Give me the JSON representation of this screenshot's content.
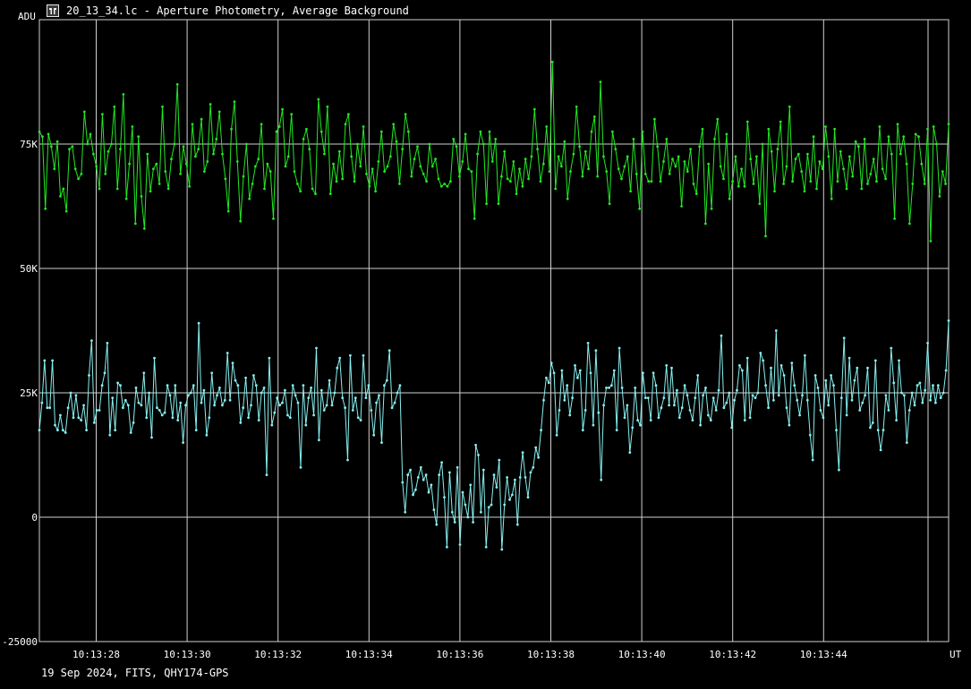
{
  "window": {
    "title": "20_13_34.lc - Aperture Photometry, Average Background",
    "icon": "app-logo-icon"
  },
  "footer": {
    "text": "19 Sep 2024, FITS, QHY174-GPS"
  },
  "chart_data": {
    "type": "line",
    "ylabel": "ADU",
    "xlabel": "UT",
    "ylim": [
      -25000,
      100000
    ],
    "xlim": [
      "10:13:26.75",
      "10:13:46.75"
    ],
    "yticks": [
      {
        "value": 75000,
        "label": "75K"
      },
      {
        "value": 50000,
        "label": "50K"
      },
      {
        "value": 25000,
        "label": "25K"
      },
      {
        "value": 0,
        "label": "0"
      },
      {
        "value": -25000,
        "label": "-25000"
      }
    ],
    "xticks": [
      {
        "value": "10:13:28",
        "label": "10:13:28"
      },
      {
        "value": "10:13:30",
        "label": "10:13:30"
      },
      {
        "value": "10:13:32",
        "label": "10:13:32"
      },
      {
        "value": "10:13:34",
        "label": "10:13:34"
      },
      {
        "value": "10:13:36",
        "label": "10:13:36"
      },
      {
        "value": "10:13:38",
        "label": "10:13:38"
      },
      {
        "value": "10:13:40",
        "label": "10:13:40"
      },
      {
        "value": "10:13:42",
        "label": "10:13:42"
      },
      {
        "value": "10:13:44",
        "label": "10:13:44"
      }
    ],
    "grid": true,
    "background": "#000000",
    "grid_color": "#d0d0d0",
    "series": [
      {
        "color": "#22e822",
        "start": "10:13:26.75",
        "interval_s": 0.04,
        "values": [
          77500,
          76500,
          62000,
          77000,
          74500,
          70000,
          75500,
          64500,
          66000,
          61500,
          74000,
          74500,
          70000,
          68000,
          69000,
          81500,
          75000,
          77000,
          73000,
          70500,
          66000,
          81000,
          69000,
          73500,
          75000,
          82500,
          66000,
          74000,
          85000,
          64000,
          71000,
          78500,
          59000,
          76500,
          64500,
          58000,
          73000,
          65500,
          70000,
          71000,
          67000,
          82500,
          69500,
          66000,
          72000,
          75000,
          87000,
          69000,
          74500,
          71000,
          66500,
          79000,
          72500,
          74000,
          80000,
          69500,
          71500,
          83000,
          73000,
          76000,
          81500,
          73000,
          68000,
          61500,
          78000,
          83500,
          71500,
          59500,
          68500,
          75000,
          64000,
          67000,
          70500,
          72000,
          79000,
          66000,
          71000,
          69500,
          60000,
          77500,
          78500,
          82000,
          70500,
          72500,
          81000,
          69500,
          67000,
          65500,
          76000,
          78000,
          74000,
          66000,
          65000,
          84000,
          77500,
          73000,
          82500,
          65000,
          71000,
          67500,
          73500,
          68000,
          79000,
          81000,
          72500,
          67500,
          75000,
          70500,
          78500,
          69000,
          66500,
          70000,
          65500,
          71500,
          77500,
          69500,
          70500,
          72500,
          79000,
          75500,
          67000,
          74000,
          81000,
          77500,
          68500,
          72000,
          74500,
          70500,
          69000,
          67500,
          75000,
          70500,
          72000,
          68000,
          66500,
          67000,
          66500,
          67500,
          76000,
          74500,
          68500,
          71500,
          77000,
          70000,
          69500,
          60000,
          73000,
          77500,
          75000,
          63000,
          77500,
          71500,
          76000,
          63000,
          68500,
          73500,
          68000,
          67500,
          71500,
          65000,
          70000,
          66500,
          72000,
          68000,
          72500,
          82000,
          74000,
          67500,
          71000,
          78500,
          69500,
          91500,
          66000,
          72500,
          70500,
          75500,
          64000,
          69500,
          73000,
          82500,
          74500,
          68500,
          73500,
          70000,
          77500,
          80500,
          68500,
          87500,
          72500,
          69500,
          63000,
          77500,
          74000,
          70000,
          68000,
          70500,
          72500,
          65500,
          76000,
          69000,
          62000,
          77500,
          69000,
          67500,
          67500,
          80000,
          74500,
          67500,
          71500,
          76000,
          69000,
          72000,
          70500,
          72500,
          62500,
          71500,
          69500,
          74000,
          67000,
          65000,
          74500,
          78000,
          59000,
          71000,
          62000,
          76000,
          80000,
          70500,
          68000,
          77000,
          64000,
          67500,
          72500,
          66500,
          70000,
          66500,
          79500,
          72000,
          67000,
          72500,
          63000,
          75000,
          56500,
          78000,
          73500,
          65500,
          74000,
          79500,
          67000,
          70500,
          82500,
          67500,
          72000,
          73000,
          69500,
          65500,
          73000,
          67500,
          76500,
          66000,
          71500,
          70000,
          78500,
          72500,
          64000,
          78000,
          67500,
          73500,
          70000,
          66000,
          72500,
          68500,
          75500,
          74500,
          66000,
          76000,
          67000,
          69000,
          72000,
          67500,
          78500,
          70000,
          68000,
          76500,
          73000,
          60000,
          79000,
          73000,
          76500,
          71000,
          59000,
          67000,
          77000,
          76500,
          71000,
          67000,
          78000,
          55500,
          78500,
          75000,
          64500,
          69500,
          67000,
          79000
        ]
      },
      {
        "color": "#88f0f0",
        "start": "10:13:26.75",
        "interval_s": 0.04,
        "values": [
          17500,
          23000,
          31500,
          22000,
          22000,
          31500,
          18500,
          17500,
          20500,
          17500,
          17000,
          22000,
          25000,
          20000,
          24500,
          20000,
          19500,
          22500,
          17500,
          28500,
          35500,
          19000,
          21500,
          21500,
          26500,
          29000,
          35000,
          16500,
          24000,
          17500,
          27000,
          26500,
          22000,
          23500,
          22500,
          17000,
          19000,
          26000,
          23000,
          22500,
          29000,
          20000,
          25000,
          16000,
          32000,
          22000,
          21500,
          20500,
          21000,
          26500,
          24500,
          20000,
          26500,
          19500,
          23000,
          15000,
          22500,
          24500,
          25000,
          26500,
          17500,
          39000,
          23000,
          25500,
          16500,
          20000,
          29000,
          22500,
          24500,
          26000,
          22500,
          23500,
          33000,
          23500,
          31000,
          27500,
          26500,
          19000,
          22000,
          28000,
          20000,
          22500,
          28500,
          26500,
          19500,
          25000,
          26000,
          8500,
          32000,
          18500,
          21000,
          24000,
          22500,
          23000,
          25500,
          20500,
          20000,
          26500,
          24500,
          23000,
          10000,
          26500,
          18500,
          24000,
          26000,
          20500,
          34000,
          15500,
          25500,
          21500,
          22500,
          27500,
          22500,
          25000,
          30000,
          32000,
          24000,
          22000,
          11500,
          32500,
          21500,
          24000,
          20000,
          19500,
          32500,
          24000,
          26500,
          21500,
          16500,
          23000,
          24500,
          15000,
          26500,
          27500,
          33500,
          22000,
          23000,
          25000,
          26500,
          7000,
          1000,
          8500,
          9500,
          4500,
          5500,
          8000,
          10000,
          7500,
          8500,
          5000,
          6500,
          1500,
          -1500,
          8500,
          11000,
          4000,
          -6000,
          9000,
          1000,
          -1000,
          10000,
          -5500,
          5000,
          2500,
          0,
          6500,
          -1000,
          14500,
          12500,
          1000,
          9500,
          -6000,
          2000,
          2500,
          8500,
          6000,
          11500,
          -6500,
          2500,
          8000,
          3500,
          4500,
          7500,
          -1500,
          8000,
          13000,
          8000,
          4000,
          9000,
          10000,
          14000,
          12000,
          17500,
          23500,
          28000,
          27000,
          31000,
          29000,
          16500,
          21500,
          29500,
          23500,
          26500,
          20500,
          24000,
          30500,
          28000,
          29500,
          17500,
          21500,
          35000,
          29000,
          18500,
          33500,
          21000,
          7500,
          22500,
          26000,
          26000,
          26500,
          29500,
          17500,
          34000,
          26000,
          20000,
          22500,
          13000,
          18000,
          26000,
          19500,
          18500,
          29000,
          24000,
          24000,
          19500,
          29000,
          26500,
          20000,
          22000,
          24000,
          30500,
          22500,
          30000,
          22500,
          25500,
          20000,
          22000,
          26500,
          24500,
          21500,
          19500,
          24000,
          28500,
          18500,
          24500,
          26000,
          20500,
          19500,
          24000,
          21500,
          25500,
          36500,
          22000,
          23000,
          25000,
          18000,
          23500,
          25500,
          30500,
          29500,
          19500,
          32000,
          20000,
          24500,
          24000,
          25000,
          33000,
          31500,
          26500,
          22000,
          30000,
          23500,
          37500,
          24500,
          30500,
          28500,
          22000,
          18500,
          31000,
          26500,
          23500,
          20500,
          24500,
          32500,
          23500,
          16500,
          11500,
          28500,
          26000,
          21500,
          20000,
          27500,
          22500,
          28500,
          26500,
          17500,
          9500,
          24000,
          36000,
          20500,
          32000,
          23500,
          27500,
          30000,
          21500,
          23000,
          24500,
          30000,
          18000,
          19000,
          31500,
          17500,
          13500,
          17500,
          24500,
          21500,
          34000,
          27000,
          19500,
          31500,
          25000,
          24500,
          15000,
          21500,
          25000,
          22500,
          26500,
          27000,
          23000,
          25500,
          35000,
          23500,
          26500,
          23000,
          26500,
          24000,
          25000,
          29500,
          39500
        ]
      }
    ]
  }
}
